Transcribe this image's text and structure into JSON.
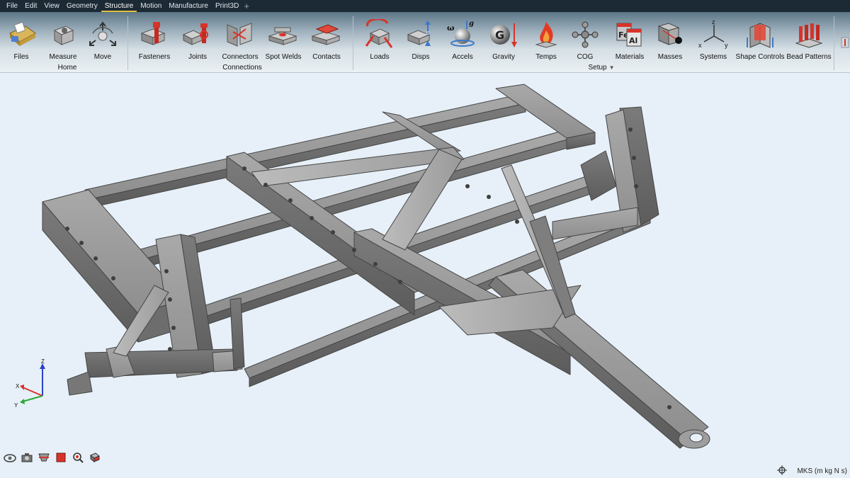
{
  "menu": {
    "items": [
      "File",
      "Edit",
      "View",
      "Geometry",
      "Structure",
      "Motion",
      "Manufacture",
      "Print3D"
    ],
    "active": "Structure",
    "add_tab_glyph": "+"
  },
  "ribbon": {
    "home": {
      "label": "Home",
      "tools": [
        {
          "label": "Files",
          "icon": "files-icon"
        },
        {
          "label": "Measure",
          "icon": "measure-icon"
        },
        {
          "label": "Move",
          "icon": "move-icon"
        }
      ]
    },
    "connections": {
      "label": "Connections",
      "tools": [
        {
          "label": "Fasteners",
          "icon": "fasteners-icon"
        },
        {
          "label": "Joints",
          "icon": "joints-icon"
        },
        {
          "label": "Connectors",
          "icon": "connectors-icon"
        },
        {
          "label": "Spot Welds",
          "icon": "spot-welds-icon"
        },
        {
          "label": "Contacts",
          "icon": "contacts-icon"
        }
      ]
    },
    "setup": {
      "label": "Setup",
      "tools": [
        {
          "label": "Loads",
          "icon": "loads-icon"
        },
        {
          "label": "Disps",
          "icon": "disps-icon"
        },
        {
          "label": "Accels",
          "icon": "accels-icon"
        },
        {
          "label": "Gravity",
          "icon": "gravity-icon"
        },
        {
          "label": "Temps",
          "icon": "temps-icon"
        },
        {
          "label": "COG",
          "icon": "cog-icon"
        },
        {
          "label": "Materials",
          "icon": "materials-icon"
        },
        {
          "label": "Masses",
          "icon": "masses-icon"
        },
        {
          "label": "Systems",
          "icon": "systems-icon"
        },
        {
          "label": "Shape Controls",
          "icon": "shape-controls-icon"
        },
        {
          "label": "Bead Patterns",
          "icon": "bead-patterns-icon"
        }
      ]
    }
  },
  "icon_glyphs": {
    "accel_omega": "ω",
    "accel_g": "g",
    "gravity_g": "G",
    "materials_fe": "Fe",
    "materials_al": "Al",
    "systems_x": "x",
    "systems_y": "y",
    "systems_z": "z",
    "disps_e": "E"
  },
  "triad": {
    "x": "X",
    "y": "Y",
    "z": "Z"
  },
  "status": {
    "units": "MKS (m kg N s)"
  },
  "colors": {
    "menubar": "#1c2a36",
    "accent_red": "#d8332a",
    "viewport_bg": "#e7f0f8",
    "model_gray": "#8a8a8a"
  }
}
